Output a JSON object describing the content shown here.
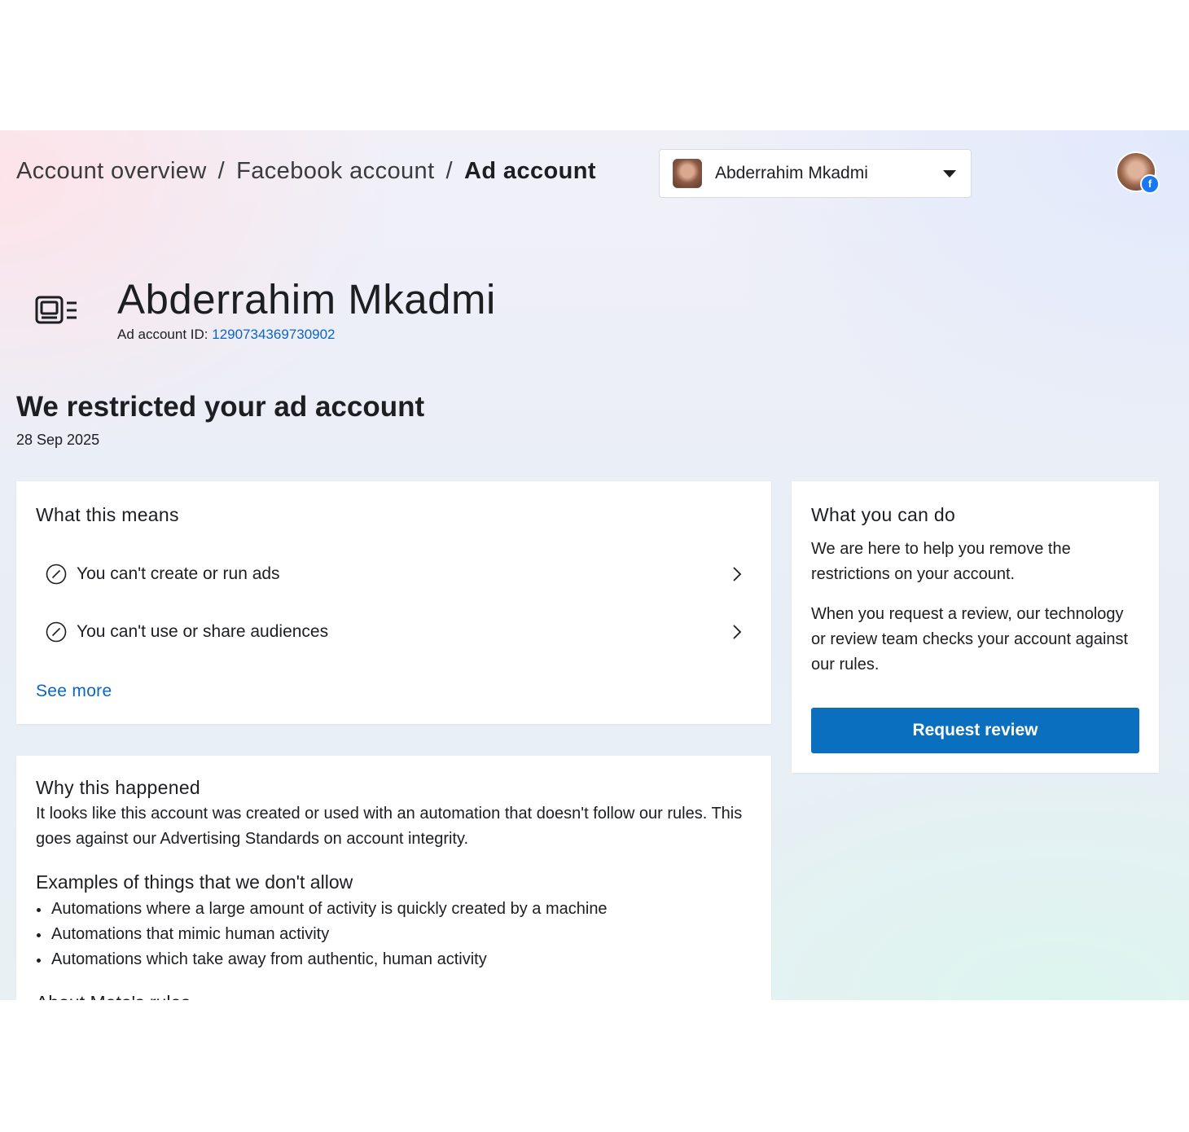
{
  "breadcrumb": {
    "items": [
      "Account overview",
      "Facebook account",
      "Ad account"
    ],
    "separator": "/"
  },
  "account_selector": {
    "selected": "Abderrahim Mkadmi",
    "icon": "caret-down-icon"
  },
  "profile": {
    "badge": "f"
  },
  "account": {
    "name": "Abderrahim Mkadmi",
    "id_label": "Ad account ID: ",
    "id_value": "1290734369730902",
    "icon": "ad-account-icon"
  },
  "restriction": {
    "title": "We restricted your ad account",
    "date": "28 Sep 2025"
  },
  "what_this_means": {
    "title": "What this means",
    "items": [
      {
        "label": "You can't create or run ads",
        "icon": "ban-icon"
      },
      {
        "label": "You can't use or share audiences",
        "icon": "ban-icon"
      }
    ],
    "see_more": "See more"
  },
  "why": {
    "title": "Why this happened",
    "body": "It looks like this account was created or used with an automation that doesn't follow our rules. This goes against our Advertising Standards on account integrity.",
    "examples_title": "Examples of things that we don't allow",
    "examples": [
      "Automations where a large amount of activity is quickly created by a machine",
      "Automations that mimic human activity",
      "Automations which take away from authentic, human activity"
    ],
    "about_title": "About Meta's rules"
  },
  "what_you_can_do": {
    "title": "What you can do",
    "p1": "We are here to help you remove the restrictions on your account.",
    "p2": "When you request a review, our technology or review team checks your account against our rules.",
    "button": "Request review"
  },
  "colors": {
    "link": "#0a66c2",
    "button": "#0b6fbf",
    "text": "#1c1e21"
  }
}
